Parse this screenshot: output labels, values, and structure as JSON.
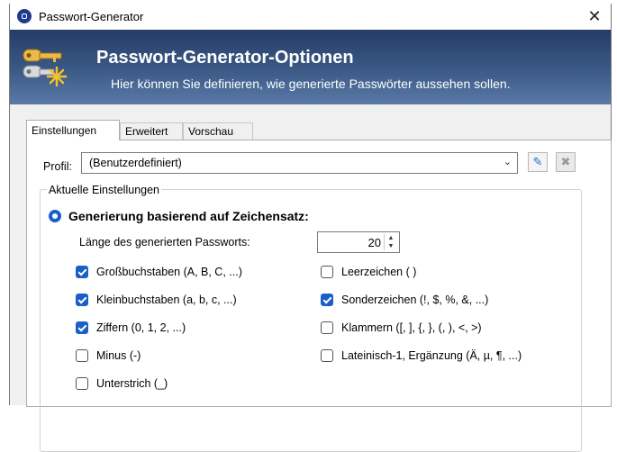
{
  "window": {
    "title": "Passwort-Generator",
    "close": "✕"
  },
  "banner": {
    "title": "Passwort-Generator-Optionen",
    "subtitle": "Hier können Sie definieren, wie generierte Passwörter aussehen sollen."
  },
  "tabs": [
    {
      "label": "Einstellungen",
      "active": true
    },
    {
      "label": "Erweitert",
      "active": false
    },
    {
      "label": "Vorschau",
      "active": false
    }
  ],
  "profile": {
    "label": "Profil:",
    "value": "(Benutzerdefiniert)",
    "edit_icon": "edit-icon",
    "delete_icon": "delete-icon"
  },
  "current_settings": {
    "group_label": "Aktuelle Einstellungen",
    "mode_label": "Generierung basierend auf Zeichensatz:",
    "mode_selected": true,
    "length_label": "Länge des generierten Passworts:",
    "length_value": "20"
  },
  "charsets_left": [
    {
      "label": "Großbuchstaben (A, B, C, ...)",
      "checked": true
    },
    {
      "label": "Kleinbuchstaben (a, b, c, ...)",
      "checked": true
    },
    {
      "label": "Ziffern (0, 1, 2, ...)",
      "checked": true
    },
    {
      "label": "Minus (-)",
      "checked": false
    },
    {
      "label": "Unterstrich (_)",
      "checked": false
    }
  ],
  "charsets_right": [
    {
      "label": "Leerzeichen ( )",
      "checked": false
    },
    {
      "label": "Sonderzeichen (!, $, %, &, ...)",
      "checked": true
    },
    {
      "label": "Klammern ([, ], {, }, (, ), <, >)",
      "checked": false
    },
    {
      "label": "Lateinisch-1, Ergänzung (Ä, µ, ¶, ...)",
      "checked": false
    }
  ],
  "colors": {
    "accent": "#1a5fc7",
    "banner": "#2f4b77"
  }
}
